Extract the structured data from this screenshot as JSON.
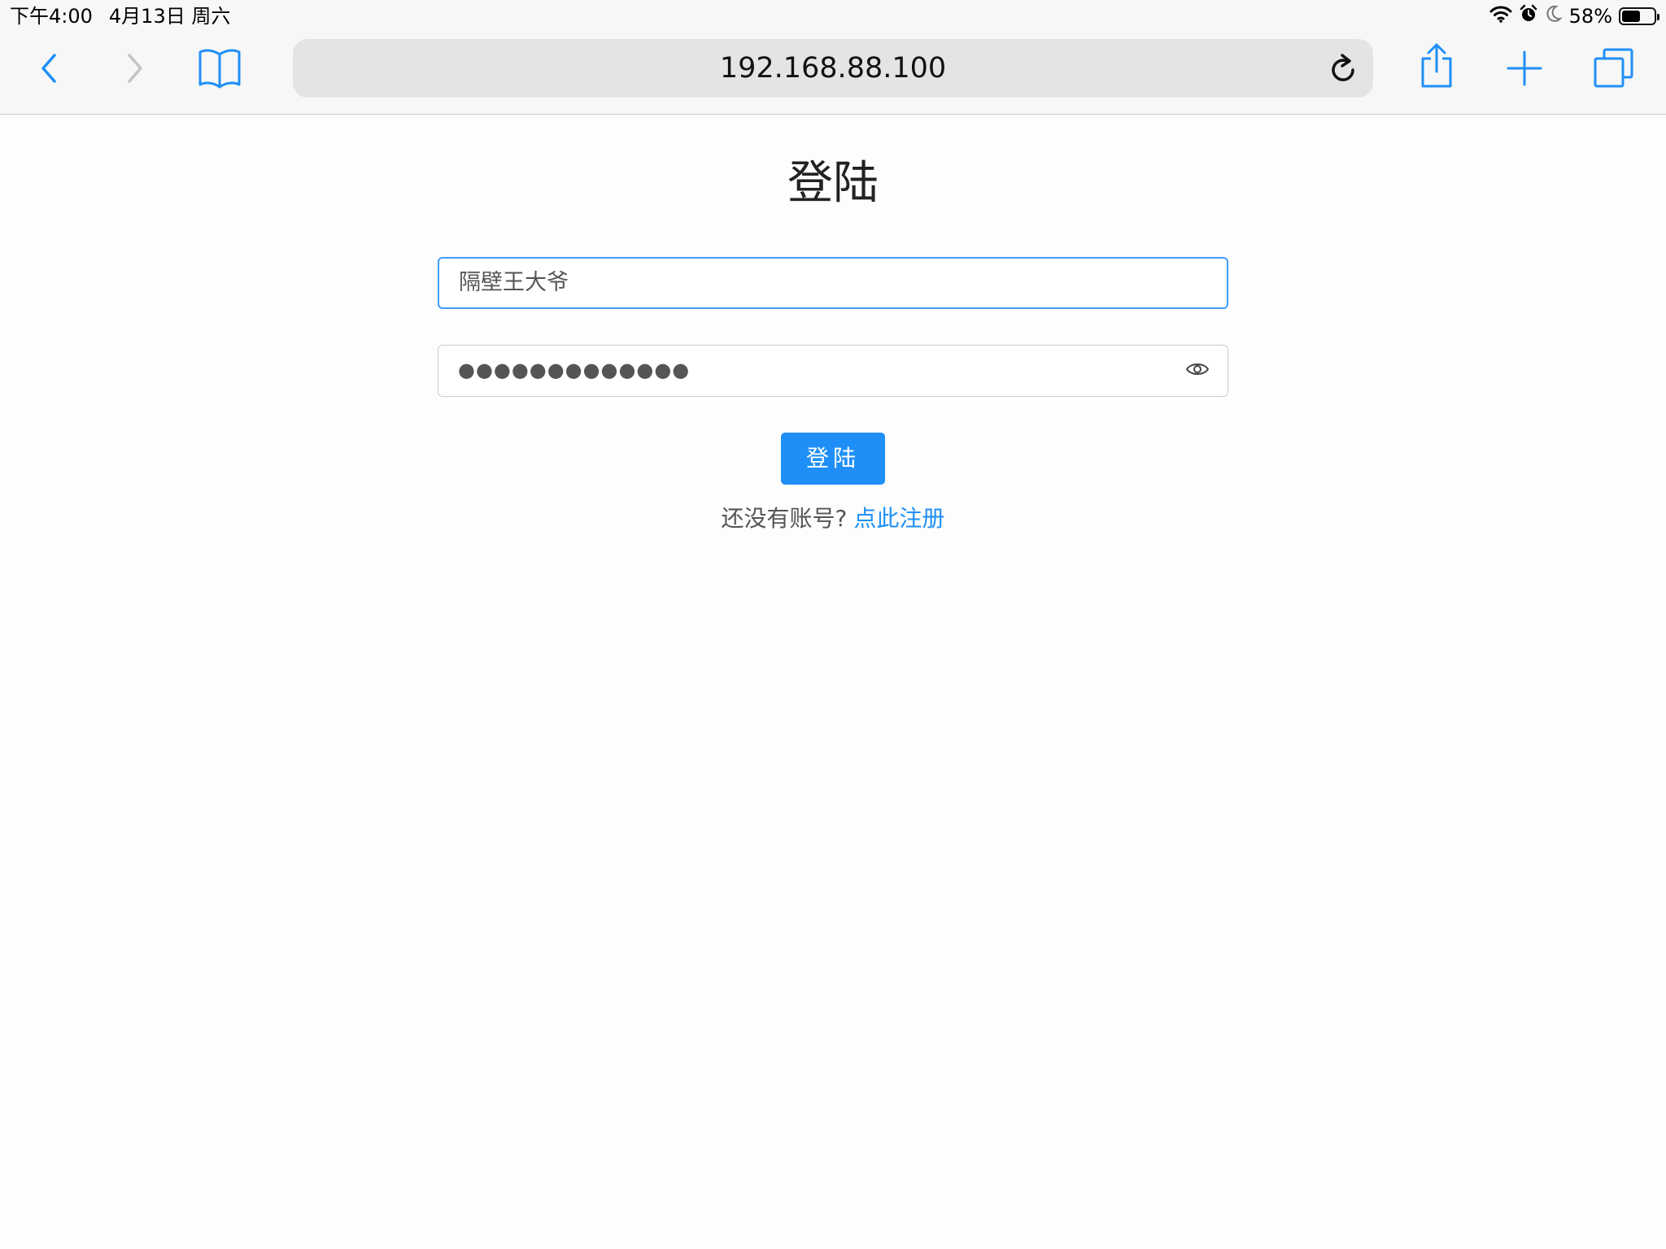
{
  "status_bar": {
    "time": "下午4:00",
    "date": "4月13日 周六",
    "battery_percent_label": "58%",
    "battery_level": 0.58,
    "icons": [
      "wifi-icon",
      "alarm-icon",
      "moon-icon",
      "battery-icon"
    ]
  },
  "browser": {
    "url": "192.168.88.100",
    "icons": [
      "back-icon",
      "forward-icon",
      "bookmarks-icon",
      "reload-icon",
      "share-icon",
      "new-tab-icon",
      "tabs-icon"
    ]
  },
  "page": {
    "title": "登陆",
    "username_value": "隔壁王大爷",
    "password_mask": "●●●●●●●●●●●●●",
    "login_button_label": "登陆",
    "register_prompt": "还没有账号?",
    "register_link": "点此注册"
  },
  "colors": {
    "accent": "#1f8ff7",
    "focus_border": "#409eff",
    "text_secondary": "#555555",
    "bar_background": "#f7f7f7"
  }
}
